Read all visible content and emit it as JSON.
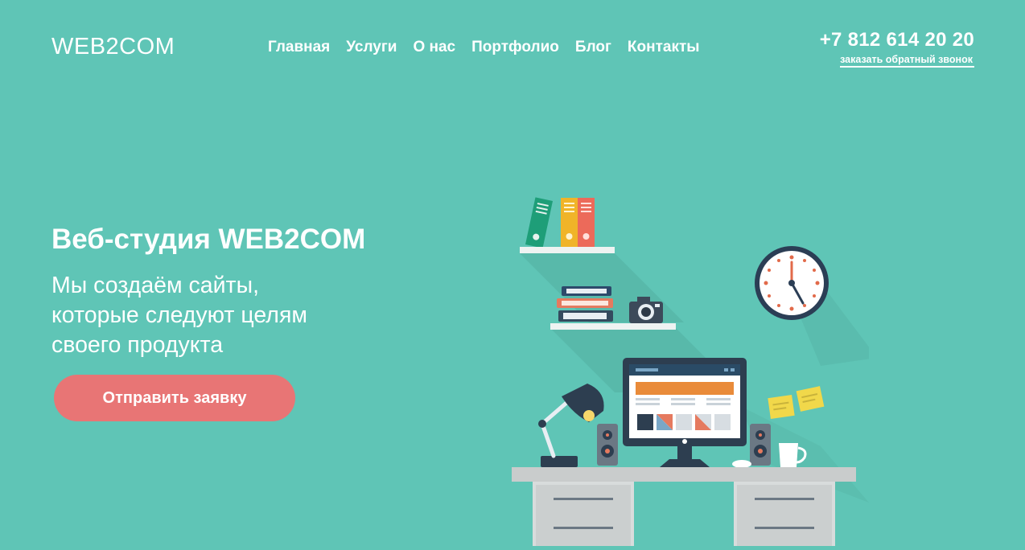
{
  "header": {
    "logo": "WEB2COM",
    "nav": [
      {
        "label": "Главная"
      },
      {
        "label": "Услуги"
      },
      {
        "label": "О нас"
      },
      {
        "label": "Портфолио"
      },
      {
        "label": "Блог"
      },
      {
        "label": "Контакты"
      }
    ],
    "phone": "+7 812 614 20 20",
    "callback_label": "заказать обратный звонок"
  },
  "hero": {
    "title": "Веб-студия WEB2COM",
    "subtitle_lines": [
      "Мы создаём сайты,",
      "которые следуют целям",
      "своего продукта"
    ],
    "cta_label": "Отправить заявку"
  },
  "illustration": {
    "icons": [
      "books-icon",
      "camera-icon",
      "clock-icon",
      "monitor-icon",
      "desk-lamp-icon",
      "speaker-icon",
      "mug-icon",
      "sticky-notes-icon",
      "desk-icon"
    ]
  },
  "colors": {
    "background": "#5fc5b6",
    "accent": "#e87575",
    "text": "#ffffff"
  }
}
